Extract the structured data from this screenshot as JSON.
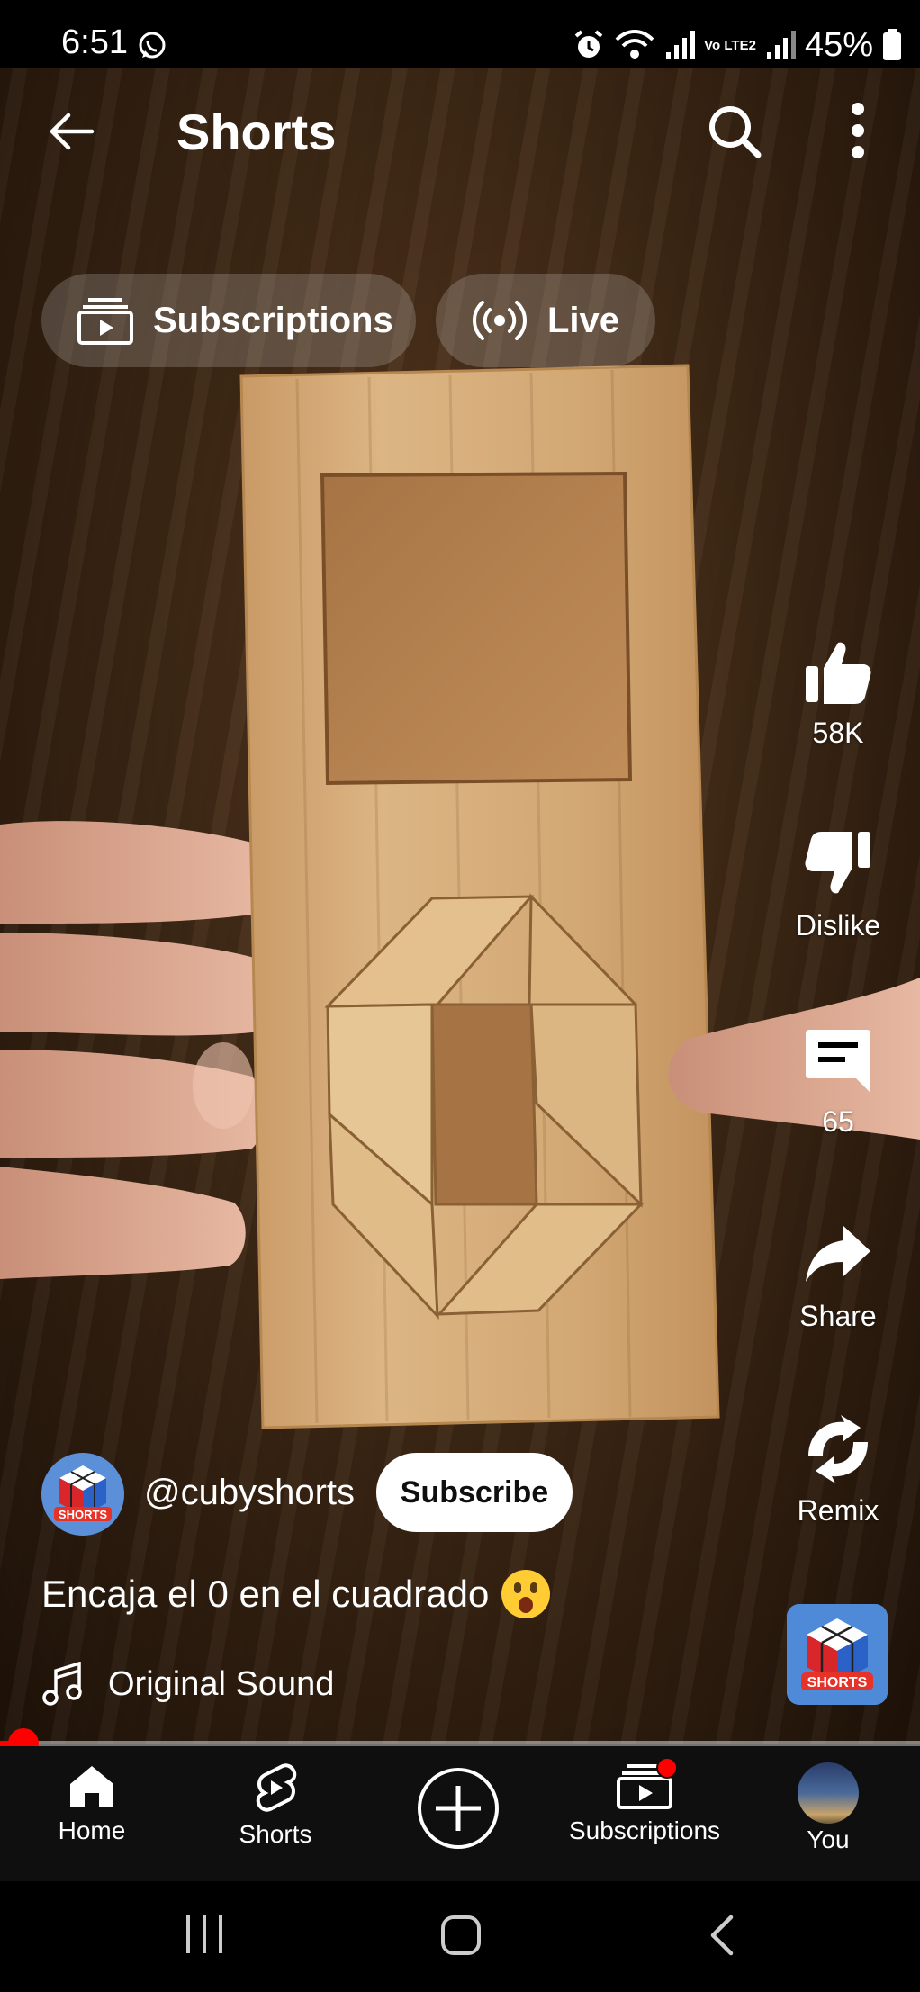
{
  "status_bar": {
    "time": "6:51",
    "network_label": "Vo LTE2",
    "battery": "45%"
  },
  "top_bar": {
    "title": "Shorts"
  },
  "chips": [
    {
      "label": "Subscriptions",
      "icon": "subscriptions-icon"
    },
    {
      "label": "Live",
      "icon": "live-icon"
    }
  ],
  "actions": {
    "like_count": "58K",
    "dislike_label": "Dislike",
    "comment_count": "65",
    "share_label": "Share",
    "remix_label": "Remix"
  },
  "channel": {
    "handle": "@cubyshorts",
    "subscribe_label": "Subscribe",
    "avatar_text": "SHORTS"
  },
  "video": {
    "title": "Encaja el 0 en el cuadrado",
    "sound": "Original Sound",
    "progress_fraction": 0.025
  },
  "bottom_nav": [
    {
      "label": "Home",
      "icon": "home-icon"
    },
    {
      "label": "Shorts",
      "icon": "shorts-icon"
    },
    {
      "label": "",
      "icon": "create-icon"
    },
    {
      "label": "Subscriptions",
      "icon": "subscriptions-icon"
    },
    {
      "label": "You",
      "icon": "avatar"
    }
  ],
  "colors": {
    "accent_red": "#ff0000",
    "nav_background": "#0f0f0f",
    "wood": "#d6ad79"
  }
}
